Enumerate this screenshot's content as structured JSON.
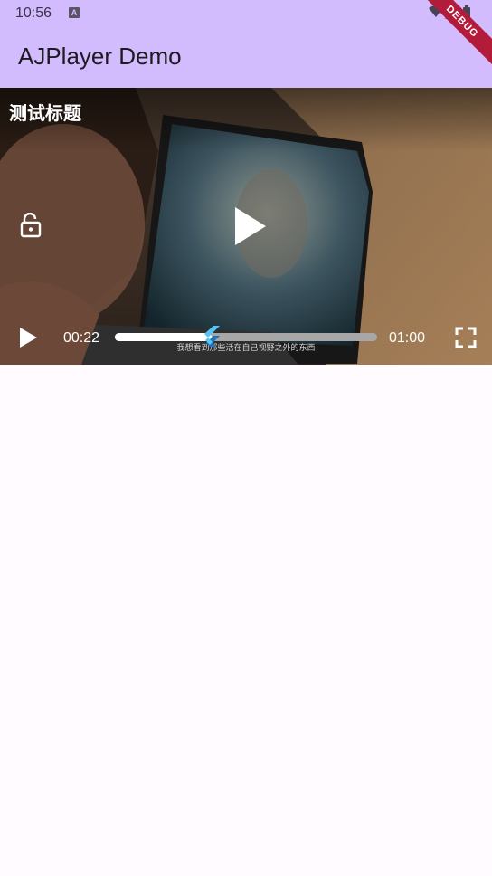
{
  "status_bar": {
    "time": "10:56",
    "a_glyph": "A",
    "debug": "DEBUG",
    "icons": [
      "a-icon",
      "wifi-icon",
      "signal-icon",
      "battery-icon"
    ]
  },
  "app_bar": {
    "title": "AJPlayer Demo"
  },
  "player": {
    "title": "测试标题",
    "subtitle": "我想看到那些活在自己视野之外的东西",
    "current_time": "00:22",
    "total_time": "01:00",
    "progress": 0.37,
    "icons": [
      "lock-open-icon",
      "play-icon",
      "fullscreen-icon",
      "flutter-thumb-icon"
    ]
  },
  "colors": {
    "app_bar": "#d2bcfd",
    "background": "#fffbfe",
    "progress_track": "#a7a7a7",
    "progress_fill": "#ffffff",
    "debug_banner": "#b31b3a"
  }
}
